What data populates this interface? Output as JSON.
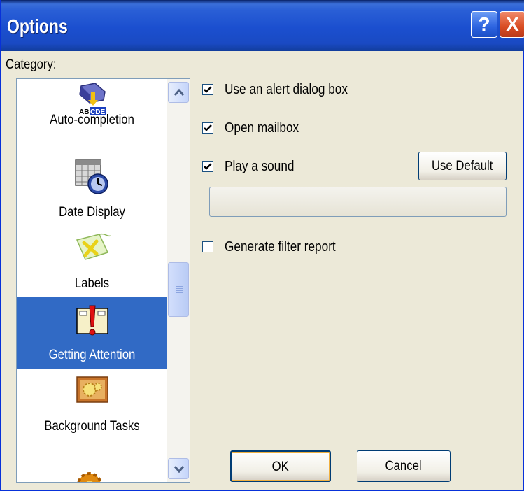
{
  "window": {
    "title": "Options",
    "help_glyph": "?",
    "close_glyph": "X"
  },
  "category": {
    "label": "Category:",
    "items": [
      {
        "label": "Auto-completion",
        "icon": "auto-completion-icon",
        "selected": false
      },
      {
        "label": "Date Display",
        "icon": "calendar-clock-icon",
        "selected": false
      },
      {
        "label": "Labels",
        "icon": "labels-icon",
        "selected": false
      },
      {
        "label": "Getting Attention",
        "icon": "alert-exclamation-icon",
        "selected": true
      },
      {
        "label": "Background Tasks",
        "icon": "background-tasks-icon",
        "selected": false
      }
    ]
  },
  "options": {
    "alert_dialog": {
      "label": "Use an alert dialog box",
      "checked": true
    },
    "open_mailbox": {
      "label": "Open mailbox",
      "checked": true
    },
    "play_sound": {
      "label": "Play a sound",
      "checked": true
    },
    "filter_report": {
      "label": "Generate filter report",
      "checked": false
    },
    "sound_file_value": ""
  },
  "buttons": {
    "use_default": "Use Default",
    "ok": "OK",
    "cancel": "Cancel"
  },
  "colors": {
    "titlebar": "#2a5fd6",
    "selection": "#316ac5",
    "dialog_bg": "#ece9d8"
  }
}
